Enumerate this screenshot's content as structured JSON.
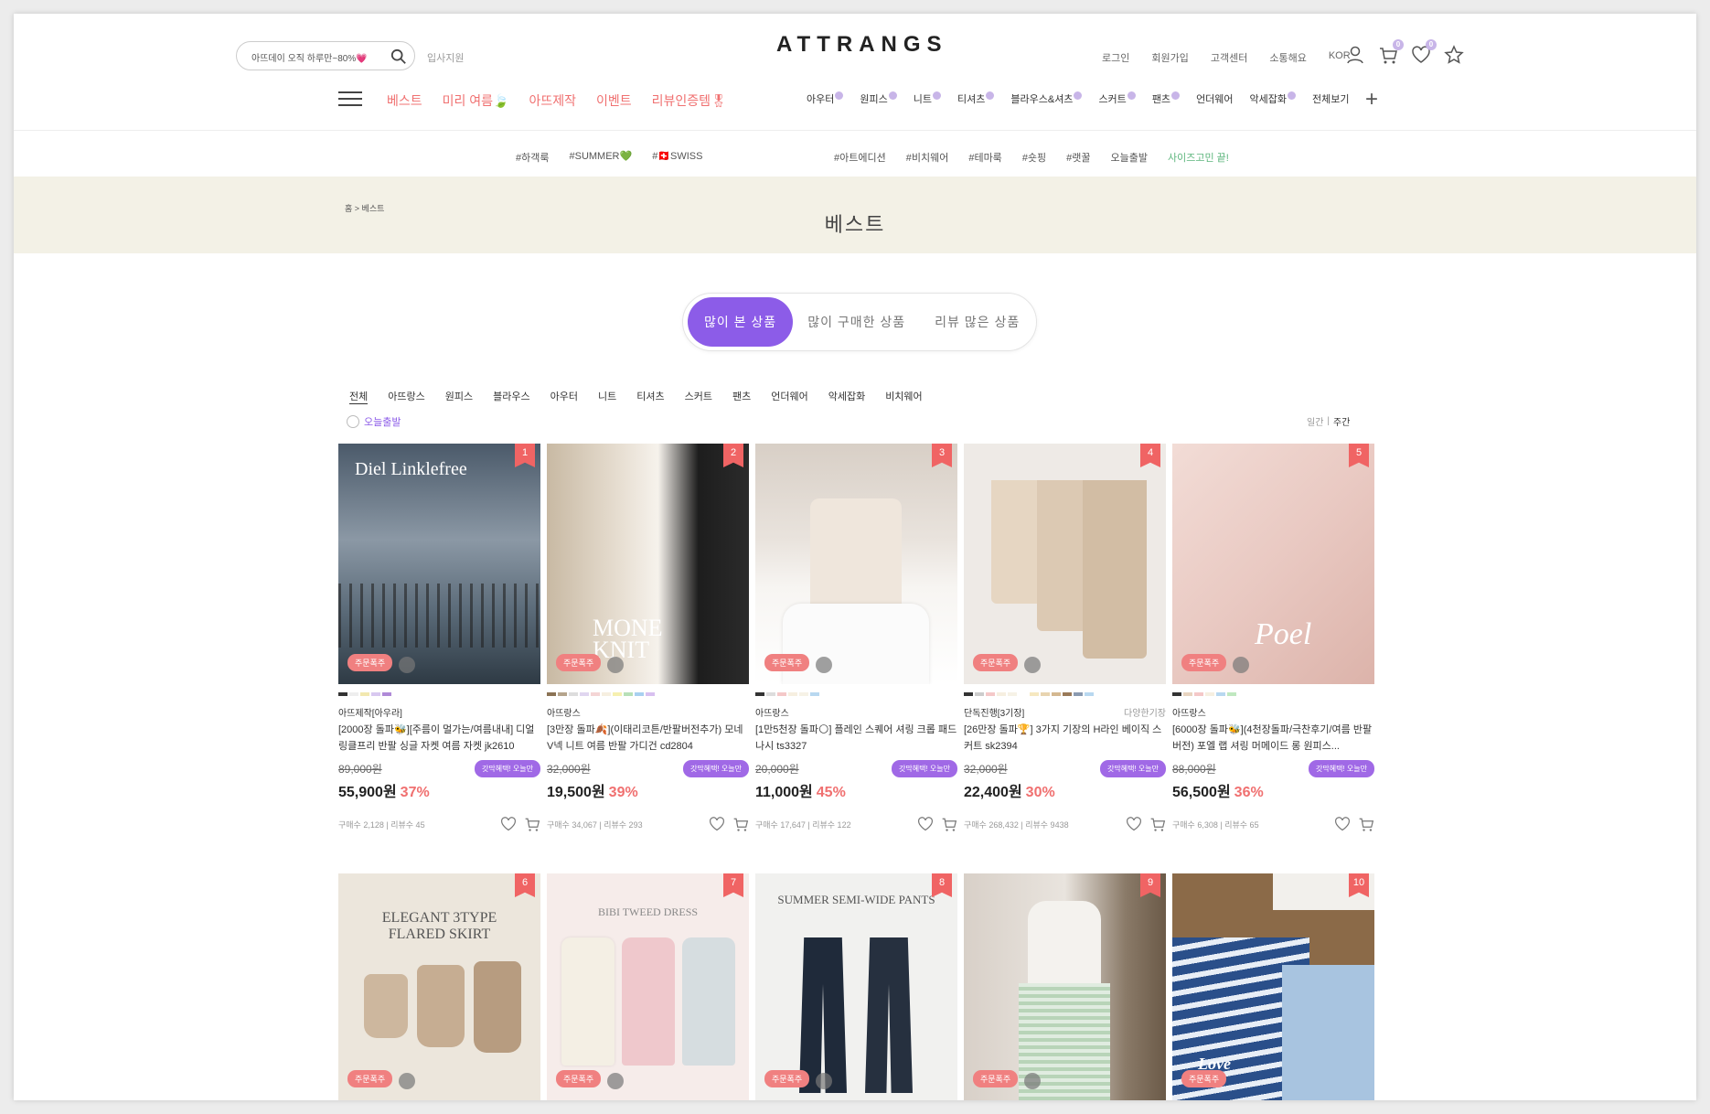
{
  "header": {
    "search_value": "아뜨데이 오직 하루만~80%💗",
    "welcome": "입사지원",
    "logo": "ATTRANGS",
    "links": [
      "로그인",
      "회원가입",
      "고객센터",
      "소통해요",
      "KOR"
    ],
    "cart_count": "0",
    "wish_count": "0"
  },
  "mainnav": [
    "베스트",
    "미리 여름🍃",
    "아뜨제작",
    "이벤트",
    "리뷰인증템🎖"
  ],
  "catnav": [
    "아우터",
    "원피스",
    "니트",
    "티셔츠",
    "블라우스&셔츠",
    "스커트",
    "팬츠",
    "언더웨어",
    "악세잡화",
    "전체보기"
  ],
  "tagnav": [
    "#하객룩",
    "#SUMMER💚",
    "#🇨🇭SWISS"
  ],
  "tagnav2": [
    "#아트에디션",
    "#비치웨어",
    "#테마룩",
    "#숏핑",
    "#랫꿀",
    "오늘출발",
    "사이즈고민 끝!"
  ],
  "page": {
    "breadcrumb": "홈 > 베스트",
    "title": "베스트"
  },
  "tabs": [
    "많이 본 상품",
    "많이 구매한 상품",
    "리뷰 많은 상품"
  ],
  "cats": [
    "전체",
    "아뜨랑스",
    "원피스",
    "블라우스",
    "아우터",
    "니트",
    "티셔츠",
    "스커트",
    "팬츠",
    "언더웨어",
    "악세잡화",
    "비치웨어"
  ],
  "filters": {
    "today": "오늘출발",
    "period_day": "일간",
    "period_week": "주간"
  },
  "order_tag": "주문폭주",
  "benefit": "갓막혜택! 오늘만",
  "products": [
    {
      "rank": "1",
      "brand": "아뜨제작[아우라]",
      "tag2": "",
      "name": "[2000장 돌파🐝][주름이 멀가는/여름내내] 디얼 링클프리 반팔 싱글 자켓 여름 자켓 jk2610",
      "orig": "89,000원",
      "price": "55,900원",
      "rate": "37%",
      "sold": "구매수 2,128",
      "reviews": "리뷰수 45",
      "overlay": "Diel Linklefree"
    },
    {
      "rank": "2",
      "brand": "아뜨랑스",
      "tag2": "",
      "name": "[3만장 돌파🍂](이태리코튼/반팔버전추가) 모네 V넥 니트 여름 반팔 가디건 cd2804",
      "orig": "32,000원",
      "price": "19,500원",
      "rate": "39%",
      "sold": "구매수 34,067",
      "reviews": "리뷰수 293",
      "overlay": "MONE KNIT"
    },
    {
      "rank": "3",
      "brand": "아뜨랑스",
      "tag2": "",
      "name": "[1만5천장 돌파🌕] 플레인 스퀘어 셔링 크롭 패드 나시 ts3327",
      "orig": "20,000원",
      "price": "11,000원",
      "rate": "45%",
      "sold": "구매수 17,647",
      "reviews": "리뷰수 122",
      "overlay": ""
    },
    {
      "rank": "4",
      "brand": "단독진행[3기장]",
      "tag2": "다양한기장",
      "name": "[26만장 돌파🏆] 3가지 기장의 H라인 베이직 스커트 sk2394",
      "orig": "32,000원",
      "price": "22,400원",
      "rate": "30%",
      "sold": "구매수 268,432",
      "reviews": "리뷰수 9438",
      "overlay": ""
    },
    {
      "rank": "5",
      "brand": "아뜨랑스",
      "tag2": "",
      "name": "[6000장 돌파🐝](4천장돌파/극찬후기/여름 반팔버전) 포엘 랩 셔링 머메이드 롱 원피스...",
      "orig": "88,000원",
      "price": "56,500원",
      "rate": "36%",
      "sold": "구매수 6,308",
      "reviews": "리뷰수 65",
      "overlay": "Poel"
    },
    {
      "rank": "6",
      "overlay": "ELEGANT 3TYPE FLARED SKIRT"
    },
    {
      "rank": "7",
      "overlay": "BIBI TWEED DRESS"
    },
    {
      "rank": "8",
      "overlay": "SUMMER SEMI-WIDE PANTS"
    },
    {
      "rank": "9",
      "overlay": ""
    },
    {
      "rank": "10",
      "overlay": "Love You"
    }
  ]
}
